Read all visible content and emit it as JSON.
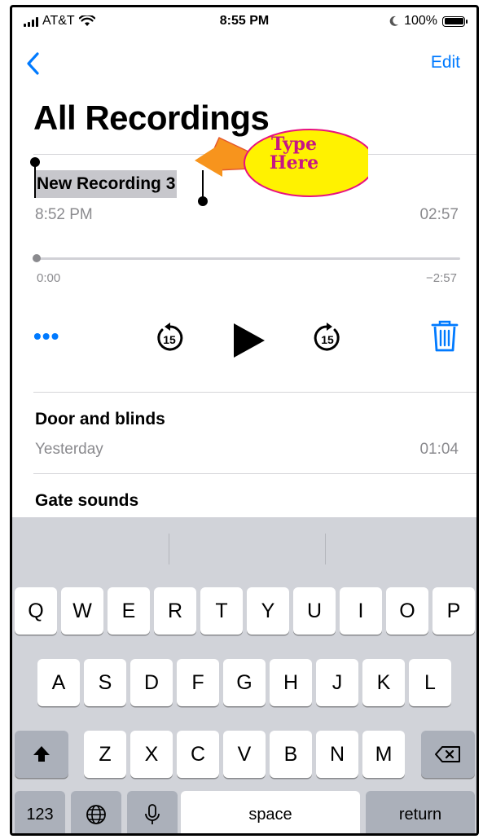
{
  "status_bar": {
    "carrier": "AT&T",
    "time": "8:55 PM",
    "battery": "100%",
    "icons": [
      "signal-icon",
      "wifi-icon",
      "moon-icon",
      "battery-icon"
    ]
  },
  "nav": {
    "back_icon": "chevron-left-icon",
    "edit_label": "Edit"
  },
  "page_title": "All Recordings",
  "current_recording": {
    "name": "New Recording 3",
    "time": "8:52 PM",
    "duration": "02:57",
    "elapsed": "0:00",
    "remaining": "−2:57",
    "progress": 0.0
  },
  "controls": {
    "more_label": "•••",
    "skip_back_label": "15",
    "skip_forward_label": "15",
    "icons": [
      "more-icon",
      "skip-back-15-icon",
      "play-icon",
      "skip-forward-15-icon",
      "trash-icon"
    ]
  },
  "recordings": [
    {
      "name": "Door and blinds",
      "date": "Yesterday",
      "duration": "01:04"
    },
    {
      "name": "Gate sounds"
    }
  ],
  "annotation": {
    "line1": "Type",
    "line2": "Here",
    "fill_color": "#fff200",
    "arrow_color": "#f7941d",
    "text_color": "#c71585"
  },
  "keyboard": {
    "row1": [
      "Q",
      "W",
      "E",
      "R",
      "T",
      "Y",
      "U",
      "I",
      "O",
      "P"
    ],
    "row2": [
      "A",
      "S",
      "D",
      "F",
      "G",
      "H",
      "J",
      "K",
      "L"
    ],
    "row3": [
      "Z",
      "X",
      "C",
      "V",
      "B",
      "N",
      "M"
    ],
    "numbers_label": "123",
    "space_label": "space",
    "return_label": "return",
    "icons": [
      "shift-icon",
      "backspace-icon",
      "globe-icon",
      "microphone-icon"
    ]
  },
  "colors": {
    "accent": "#007aff",
    "secondary_text": "#8a8a8e",
    "keyboard_bg": "#d1d3d9",
    "selection": "#c7c7cc"
  }
}
